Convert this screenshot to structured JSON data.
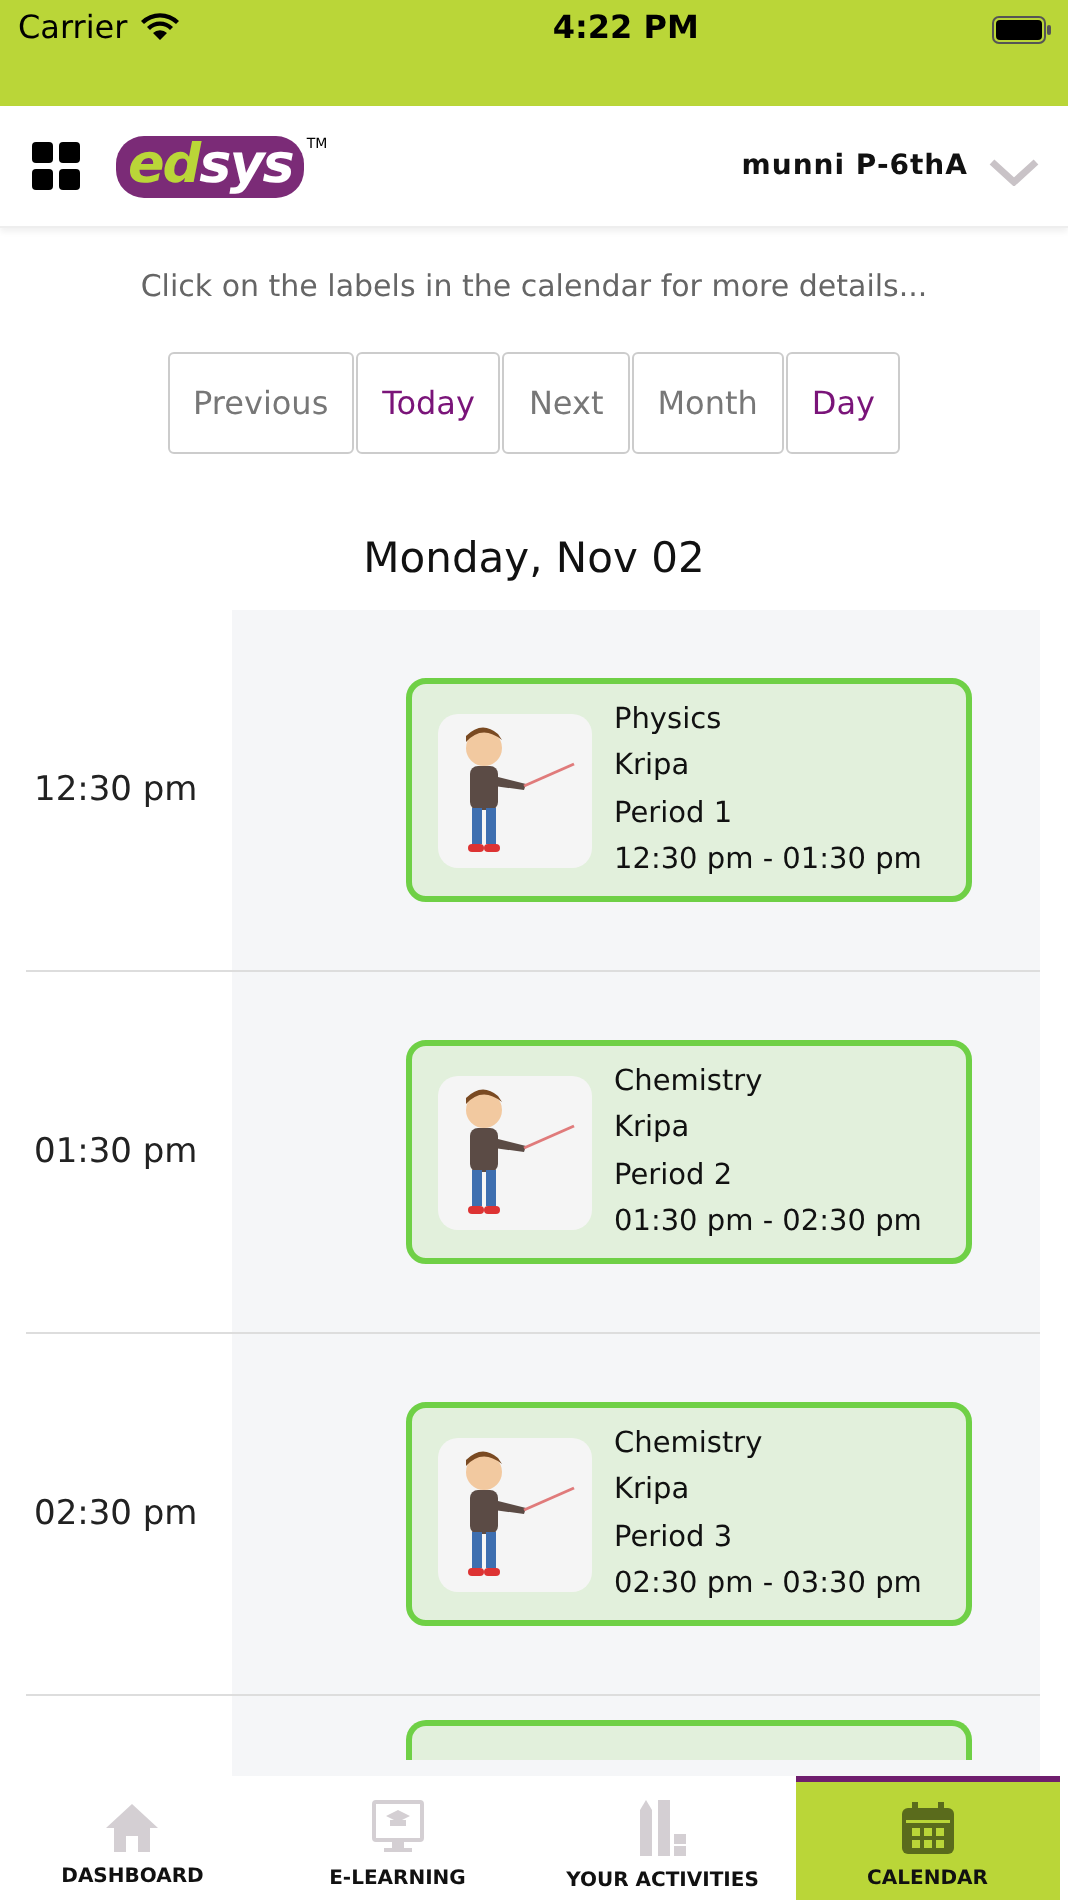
{
  "status_bar": {
    "carrier": "Carrier",
    "time": "4:22 PM"
  },
  "header": {
    "logo": {
      "first": "ed",
      "second": "sys",
      "mark": "TM"
    },
    "user": "munni P-6thA"
  },
  "hint": "Click on the labels in the calendar for more details...",
  "nav_buttons": [
    {
      "label": "Previous",
      "active": false
    },
    {
      "label": "Today",
      "active": true
    },
    {
      "label": "Next",
      "active": false
    },
    {
      "label": "Month",
      "active": false
    },
    {
      "label": "Day",
      "active": true
    }
  ],
  "date_title": "Monday, Nov 02",
  "slots": [
    {
      "time": "12:30 pm",
      "event": {
        "subject": "Physics",
        "teacher": "Kripa",
        "period": "Period 1",
        "range": "12:30 pm - 01:30 pm"
      }
    },
    {
      "time": "01:30 pm",
      "event": {
        "subject": "Chemistry",
        "teacher": "Kripa",
        "period": "Period 2",
        "range": "01:30 pm - 02:30 pm"
      }
    },
    {
      "time": "02:30 pm",
      "event": {
        "subject": "Chemistry",
        "teacher": "Kripa",
        "period": "Period 3",
        "range": "02:30 pm - 03:30 pm"
      }
    }
  ],
  "tabs": [
    {
      "label": "DASHBOARD",
      "kind": "home",
      "selected": false
    },
    {
      "label": "E-LEARNING",
      "kind": "elearning",
      "selected": false
    },
    {
      "label": "YOUR ACTIVITIES",
      "kind": "activities",
      "selected": false
    },
    {
      "label": "CALENDAR",
      "kind": "calendar",
      "selected": true
    }
  ]
}
